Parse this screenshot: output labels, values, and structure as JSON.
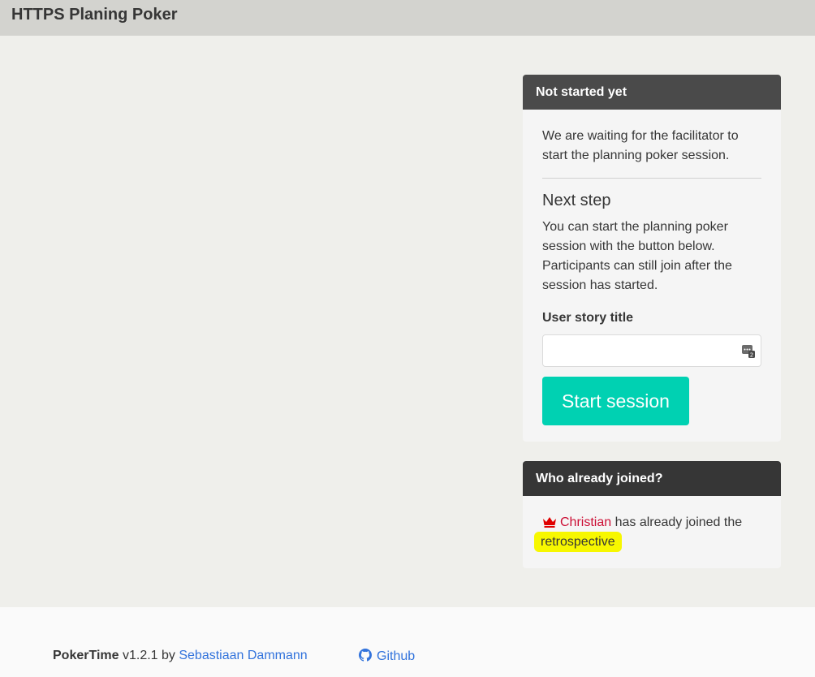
{
  "navbar": {
    "title": "HTTPS Planing Poker"
  },
  "status_panel": {
    "header": "Not started yet",
    "waiting_text": "We are waiting for the facilitator to start the planning poker session.",
    "next_step_heading": "Next step",
    "next_step_text": "You can start the planning poker session with the button below. Participants can still join after the session has started.",
    "field_label": "User story title",
    "field_value": "",
    "field_placeholder": "",
    "start_button": "Start session"
  },
  "joined_panel": {
    "header": "Who already joined?",
    "participant_name": "Christian",
    "joined_text": " has already joined the ",
    "session_type": "retrospective"
  },
  "footer": {
    "app_name": "PokerTime",
    "version": " v1.2.1 by ",
    "author": "Sebastiaan Dammann",
    "github_label": "Github"
  },
  "colors": {
    "accent": "#00d1b2",
    "link": "#3273dc",
    "participant": "#cc0f35",
    "highlight": "#f7f700"
  }
}
